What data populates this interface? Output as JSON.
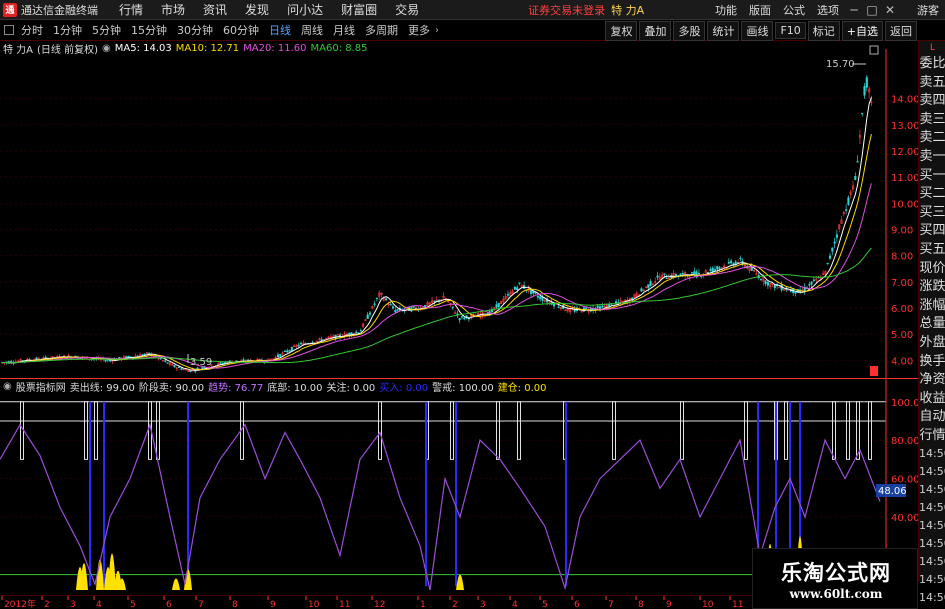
{
  "titlebar": {
    "app_title": "通达信金融终端",
    "menu": [
      "行情",
      "市场",
      "资讯",
      "发现",
      "问小达",
      "财富圈",
      "交易"
    ],
    "warning": "证券交易未登录",
    "stock_name": "特 力A",
    "right_items": [
      "功能",
      "版面",
      "公式",
      "选项"
    ],
    "guest": "游客"
  },
  "toolbar": {
    "periods": [
      "分时",
      "1分钟",
      "5分钟",
      "15分钟",
      "30分钟",
      "60分钟",
      "日线",
      "周线",
      "月线",
      "多周期",
      "更多"
    ],
    "active_period": "日线",
    "buttons": [
      "复权",
      "叠加",
      "多股",
      "统计",
      "画线",
      "F10",
      "标记",
      "+自选",
      "返回"
    ]
  },
  "main_legend": {
    "stock": "特 力A",
    "mode": "(日线 前复权)",
    "ma5": "MA5: 14.03",
    "ma10": "MA10: 12.71",
    "ma20": "MA20: 11.60",
    "ma60": "MA60: 8.85"
  },
  "price_axis": [
    "14.00",
    "13.00",
    "12.00",
    "11.00",
    "10.00",
    "9.00",
    "8.00",
    "7.00",
    "6.00",
    "5.00",
    "4.00"
  ],
  "annotations": {
    "high": "15.70",
    "low": "3.59"
  },
  "indicator_legend": {
    "name": "股票指标网",
    "sell_line": "卖出线: 99.00",
    "stage_sell": "阶段卖: 90.00",
    "trend": "趋势: 76.77",
    "bottom": "底部: 10.00",
    "focus": "关注: 0.00",
    "ambush": "买入: 0.00",
    "alert": "警戒: 100.00",
    "position": "建仓: 0.00"
  },
  "indicator_axis": [
    "100.00",
    "80.00",
    "60.00",
    "40.00"
  ],
  "indicator_current": "48.06",
  "sidebar": {
    "items": [
      "委比",
      "卖五",
      "卖四",
      "卖三",
      "卖二",
      "卖一",
      "买一",
      "买二",
      "买三",
      "买四",
      "买五",
      "现价",
      "涨跌",
      "涨幅",
      "总量",
      "外盘",
      "换手",
      "净资",
      "收益",
      "自动",
      "行情"
    ],
    "times": [
      "14:50",
      "14:50",
      "14:50",
      "14:50",
      "14:50",
      "14:50",
      "14:50",
      "14:50",
      "14:50",
      "14:50"
    ]
  },
  "date_axis": [
    "2012年",
    "2",
    "3",
    "4",
    "5",
    "6",
    "7",
    "8",
    "9",
    "10",
    "11",
    "12",
    "1",
    "2",
    "3",
    "4",
    "5",
    "6",
    "7",
    "8",
    "9",
    "10",
    "11",
    "12"
  ],
  "watermark": {
    "title": "乐淘公式网",
    "url": "www.60lt.com"
  },
  "colors": {
    "bg": "#000000",
    "up": "#ff3c3c",
    "down": "#32d2d2",
    "ma5": "#ffffff",
    "ma10": "#ffd700",
    "ma20": "#e050e0",
    "ma60": "#32c832",
    "trend": "#9a4ed8",
    "bar_white": "#e0e0e0",
    "bar_blue": "#2a2aff",
    "bar_yellow": "#ffe000",
    "axis": "#ff3030"
  }
}
